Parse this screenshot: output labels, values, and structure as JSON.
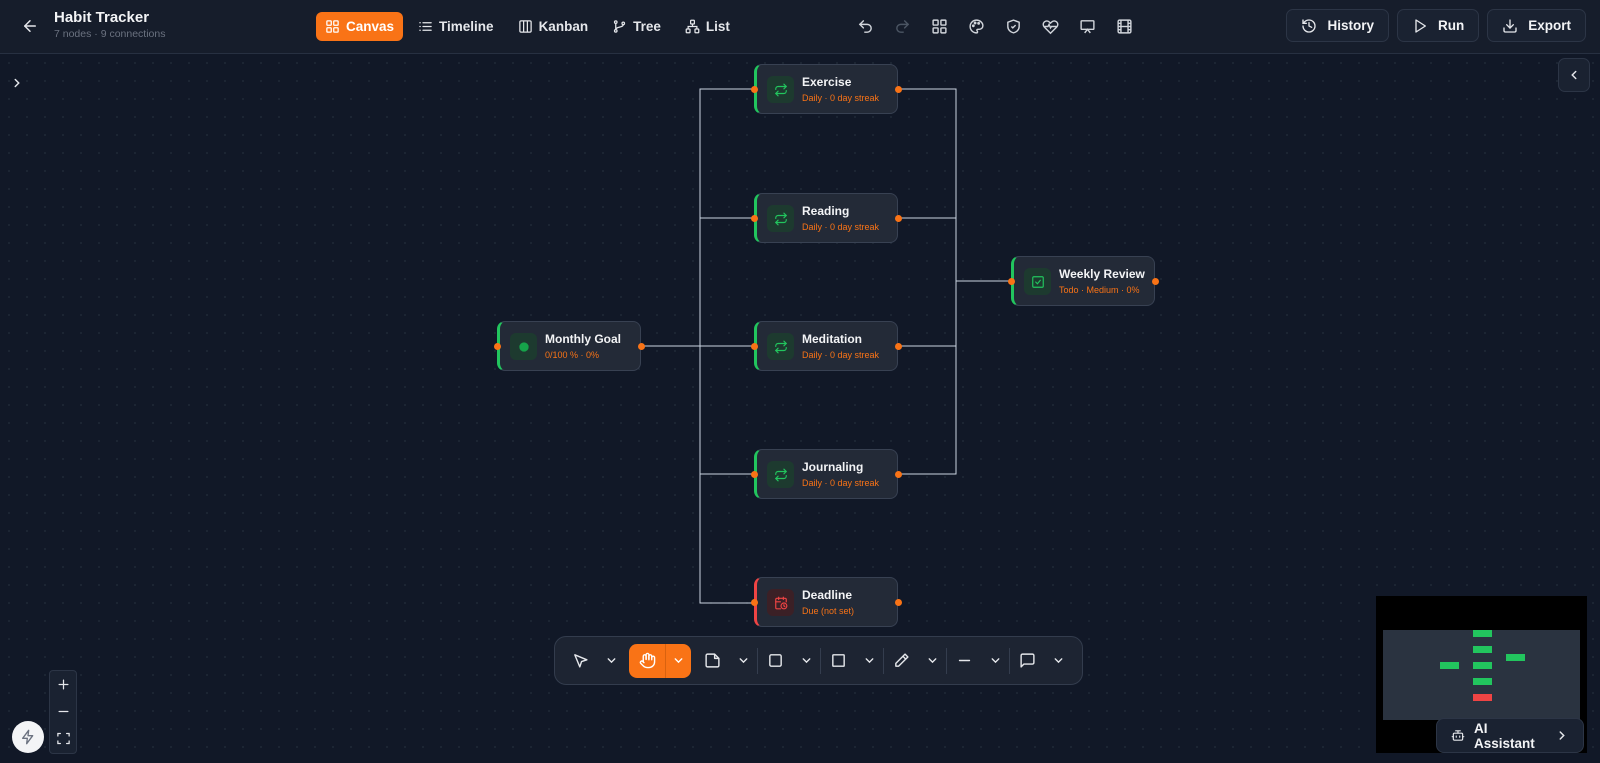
{
  "header": {
    "title": "Habit Tracker",
    "subtitle": "7 nodes · 9 connections",
    "views": [
      {
        "label": "Canvas",
        "icon": "grid-icon",
        "active": true
      },
      {
        "label": "Timeline",
        "icon": "list-lines-icon",
        "active": false
      },
      {
        "label": "Kanban",
        "icon": "columns-icon",
        "active": false
      },
      {
        "label": "Tree",
        "icon": "branch-icon",
        "active": false
      },
      {
        "label": "List",
        "icon": "hierarchy-icon",
        "active": false
      }
    ],
    "tools": [
      "undo-icon",
      "redo-icon",
      "layout-grid-icon",
      "palette-icon",
      "shield-icon",
      "heart-pulse-icon",
      "presentation-icon",
      "film-icon"
    ],
    "history_label": "History",
    "run_label": "Run",
    "export_label": "Export"
  },
  "nodes": [
    {
      "id": "goal",
      "title": "Monthly Goal",
      "subtitle": "0/100 % · 0%",
      "icon": "target-dot-icon",
      "status": "green"
    },
    {
      "id": "exercise",
      "title": "Exercise",
      "subtitle": "Daily · 0 day streak",
      "icon": "repeat-icon",
      "status": "green"
    },
    {
      "id": "reading",
      "title": "Reading",
      "subtitle": "Daily · 0 day streak",
      "icon": "repeat-icon",
      "status": "green"
    },
    {
      "id": "meditation",
      "title": "Meditation",
      "subtitle": "Daily · 0 day streak",
      "icon": "repeat-icon",
      "status": "green"
    },
    {
      "id": "journaling",
      "title": "Journaling",
      "subtitle": "Daily · 0 day streak",
      "icon": "repeat-icon",
      "status": "green"
    },
    {
      "id": "deadline",
      "title": "Deadline",
      "subtitle": "Due (not set)",
      "icon": "calendar-clock-icon",
      "status": "red"
    },
    {
      "id": "review",
      "title": "Weekly Review",
      "subtitle": "Todo · Medium · 0%",
      "icon": "check-square-icon",
      "status": "green"
    }
  ],
  "toolbar": {
    "tools": [
      "pointer-icon",
      "hand-icon",
      "sticky-note-icon",
      "frame-icon",
      "rectangle-icon",
      "pen-icon",
      "line-icon",
      "comment-icon"
    ],
    "active": "hand-icon"
  },
  "ai_assistant_label": "AI Assistant",
  "colors": {
    "accent": "#f97316",
    "success": "#22c55e",
    "danger": "#ef4444",
    "background": "#111827"
  }
}
